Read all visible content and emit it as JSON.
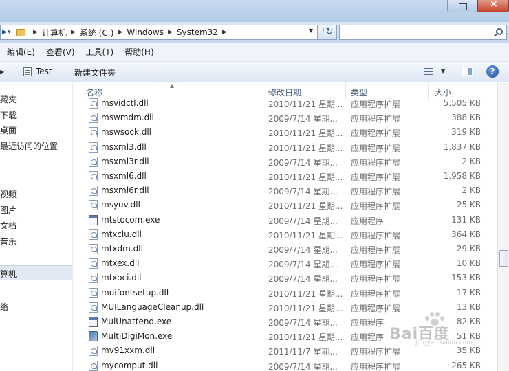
{
  "address_bar": {
    "crumbs": [
      "计算机",
      "系统 (C:)",
      "Windows",
      "System32"
    ]
  },
  "search": {
    "placeholder": ""
  },
  "menu": [
    "编辑(E)",
    "查看(V)",
    "工具(T)",
    "帮助(H)"
  ],
  "toolbar": {
    "test_label": "Test",
    "new_folder_label": "新建文件夹"
  },
  "nav_items": [
    "藏夹",
    "下载",
    "桌面",
    "最近访问的位置",
    "",
    "视频",
    "图片",
    "文档",
    "音乐",
    "算机",
    "络"
  ],
  "columns": {
    "name": "名称",
    "date": "修改日期",
    "type": "类型",
    "size": "大小"
  },
  "files": [
    {
      "name": "msvidctl.dll",
      "date": "2010/11/21 星期...",
      "type": "应用程序扩展",
      "size": "5,505 KB",
      "icon": "dll-file-icon"
    },
    {
      "name": "mswmdm.dll",
      "date": "2009/7/14 星期...",
      "type": "应用程序扩展",
      "size": "388 KB",
      "icon": "dll-file-icon"
    },
    {
      "name": "mswsock.dll",
      "date": "2010/11/21 星期...",
      "type": "应用程序扩展",
      "size": "319 KB",
      "icon": "dll-file-icon"
    },
    {
      "name": "msxml3.dll",
      "date": "2010/11/21 星期...",
      "type": "应用程序扩展",
      "size": "1,837 KB",
      "icon": "dll-file-icon"
    },
    {
      "name": "msxml3r.dll",
      "date": "2009/7/14 星期...",
      "type": "应用程序扩展",
      "size": "2 KB",
      "icon": "dll-file-icon"
    },
    {
      "name": "msxml6.dll",
      "date": "2010/11/21 星期...",
      "type": "应用程序扩展",
      "size": "1,958 KB",
      "icon": "dll-file-icon"
    },
    {
      "name": "msxml6r.dll",
      "date": "2009/7/14 星期...",
      "type": "应用程序扩展",
      "size": "2 KB",
      "icon": "dll-file-icon"
    },
    {
      "name": "msyuv.dll",
      "date": "2010/11/21 星期...",
      "type": "应用程序扩展",
      "size": "25 KB",
      "icon": "dll-file-icon"
    },
    {
      "name": "mtstocom.exe",
      "date": "2009/7/14 星期...",
      "type": "应用程序",
      "size": "131 KB",
      "icon": "exe-window-icon"
    },
    {
      "name": "mtxclu.dll",
      "date": "2010/11/21 星期...",
      "type": "应用程序扩展",
      "size": "364 KB",
      "icon": "dll-file-icon"
    },
    {
      "name": "mtxdm.dll",
      "date": "2009/7/14 星期...",
      "type": "应用程序扩展",
      "size": "29 KB",
      "icon": "dll-file-icon"
    },
    {
      "name": "mtxex.dll",
      "date": "2009/7/14 星期...",
      "type": "应用程序扩展",
      "size": "10 KB",
      "icon": "dll-file-icon"
    },
    {
      "name": "mtxoci.dll",
      "date": "2009/7/14 星期...",
      "type": "应用程序扩展",
      "size": "153 KB",
      "icon": "dll-file-icon"
    },
    {
      "name": "muifontsetup.dll",
      "date": "2010/11/21 星期...",
      "type": "应用程序扩展",
      "size": "17 KB",
      "icon": "dll-file-icon"
    },
    {
      "name": "MUILanguageCleanup.dll",
      "date": "2010/11/21 星期...",
      "type": "应用程序扩展",
      "size": "13 KB",
      "icon": "dll-file-icon"
    },
    {
      "name": "MuiUnattend.exe",
      "date": "2009/7/14 星期...",
      "type": "应用程序",
      "size": "82 KB",
      "icon": "exe-window-icon"
    },
    {
      "name": "MultiDigiMon.exe",
      "date": "2010/11/21 星期...",
      "type": "应用程序",
      "size": "51 KB",
      "icon": "app-exe-icon"
    },
    {
      "name": "mv91xxm.dll",
      "date": "2011/11/7 星期...",
      "type": "应用程序扩展",
      "size": "35 KB",
      "icon": "dll-file-icon"
    },
    {
      "name": "mycomput.dll",
      "date": "2009/7/14 星期...",
      "type": "应用程序扩展",
      "size": "265 KB",
      "icon": "dll-file-icon"
    }
  ],
  "watermark": {
    "text": "Bai百度",
    "sub": "jingyan.baidu.com"
  },
  "colors": {
    "selection": "#e2e8f2",
    "header_text": "#4c607a",
    "muted_text": "#6d6d6d"
  }
}
